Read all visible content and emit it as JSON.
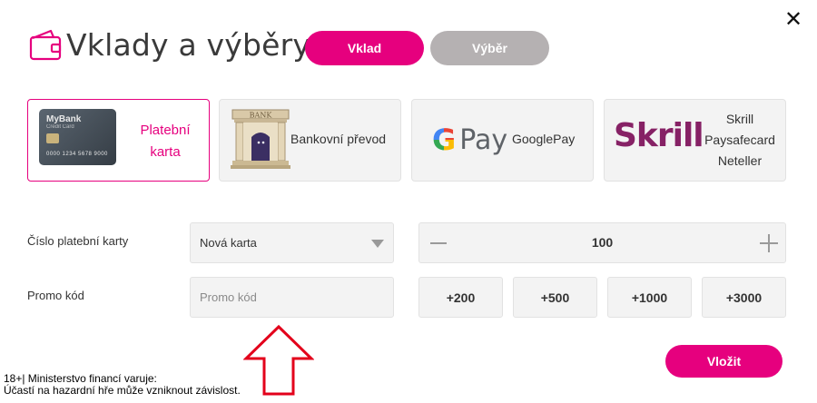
{
  "header": {
    "title": "Vklady a výběry",
    "tabs": [
      {
        "label": "Vklad",
        "active": true
      },
      {
        "label": "Výběr",
        "active": false
      }
    ],
    "close_label": "✕"
  },
  "methods": [
    {
      "label_line1": "Platební",
      "label_line2": "karta",
      "card_name": "MyBank",
      "card_subtitle": "Credit Card",
      "card_number": "0000 1234 5678 9000",
      "active": true
    },
    {
      "label": "Bankovní převod",
      "image_text": "BANK"
    },
    {
      "logo_g": "G",
      "logo_pay": "Pay",
      "label": "GooglePay"
    },
    {
      "logo": "Skrill",
      "lines": [
        "Skrill",
        "Paysafecard",
        "Neteller"
      ]
    }
  ],
  "form": {
    "card_label": "Číslo platební karty",
    "card_select_value": "Nová karta",
    "promo_label": "Promo kód",
    "promo_placeholder": "Promo kód",
    "amount_value": "100",
    "quick_amounts": [
      "+200",
      "+500",
      "+1000",
      "+3000"
    ],
    "submit_label": "Vložit"
  },
  "disclaimer": {
    "line1": "18+| Ministerstvo financí varuje:",
    "line2": "Účastí na hazardní hře může vzniknout závislost."
  },
  "colors": {
    "accent": "#e6007e",
    "inactive_tab": "#b5b1b2",
    "skrill": "#862165"
  }
}
